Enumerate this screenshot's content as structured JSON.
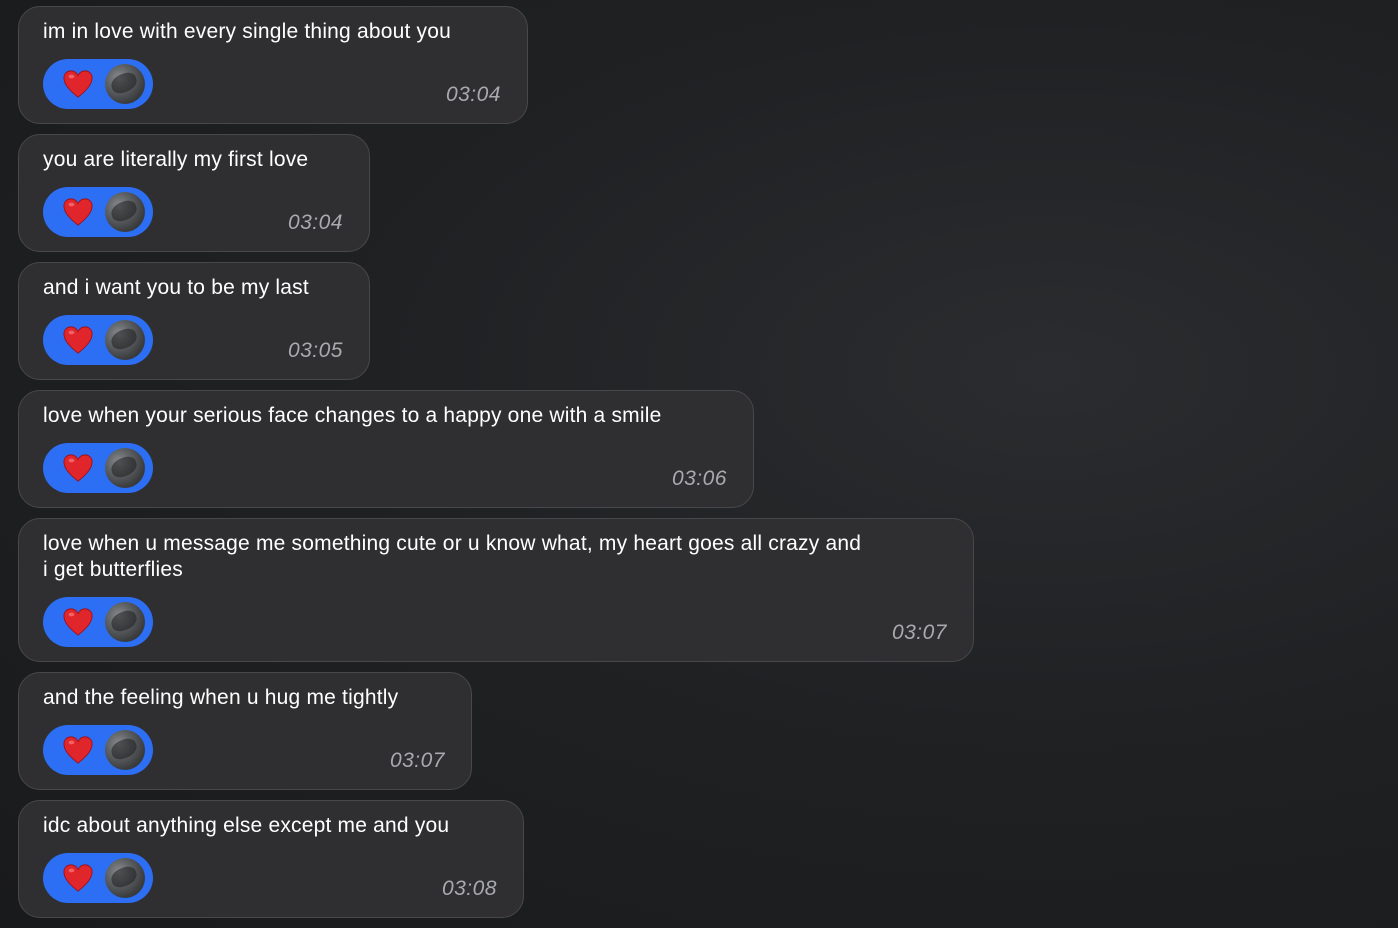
{
  "messages": [
    {
      "text": "im in love with every single thing about you",
      "time": "03:04",
      "reaction": "heart"
    },
    {
      "text": "you are literally my first love",
      "time": "03:04",
      "reaction": "heart"
    },
    {
      "text": "and i want you to be my last",
      "time": "03:05",
      "reaction": "heart"
    },
    {
      "text": "love when your serious face changes to a happy one with a smile",
      "time": "03:06",
      "reaction": "heart"
    },
    {
      "text": "love when u message me something cute or u know what, my heart goes all crazy and\ni get butterflies",
      "time": "03:07",
      "reaction": "heart"
    },
    {
      "text": "and the feeling when u hug me tightly",
      "time": "03:07",
      "reaction": "heart"
    },
    {
      "text": "idc about anything else except me and you",
      "time": "03:08",
      "reaction": "heart"
    }
  ],
  "colors": {
    "bubble": "#2f2f31",
    "reaction_pill": "#2c6ff5",
    "heart": "#e0262b",
    "timestamp": "#a9aaae"
  }
}
